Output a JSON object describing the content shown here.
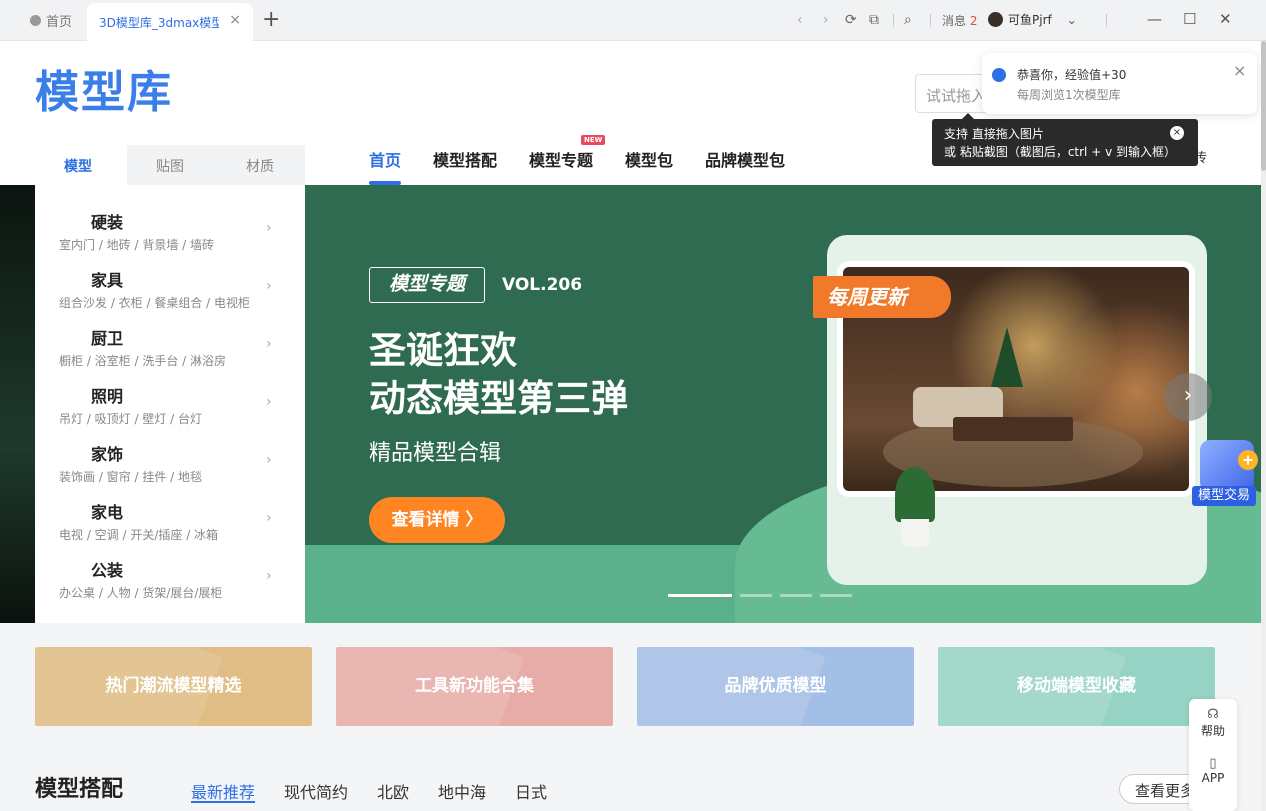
{
  "browser": {
    "home_tab": "首页",
    "active_tab": "3D模型库_3dmax模型库",
    "close": "×",
    "new_tab": "+",
    "back": "‹",
    "forward": "›",
    "reload": "⟳",
    "copy": "⧉",
    "search": "⌕",
    "messages_label": "消息",
    "messages_count": "2",
    "username": "可鱼Pjrf",
    "dropdown": "⌄",
    "minimize": "—",
    "maximize": "☐",
    "close_window": "✕"
  },
  "header": {
    "logo": "模型库",
    "search_placeholder": "试试拖入"
  },
  "side_tabs": [
    "模型",
    "贴图",
    "材质"
  ],
  "main_nav": [
    {
      "label": "首页"
    },
    {
      "label": "模型搭配"
    },
    {
      "label": "模型专题",
      "badge": "NEW"
    },
    {
      "label": "模型包"
    },
    {
      "label": "品牌模型包"
    }
  ],
  "upload_label": "模型上传",
  "categories": [
    {
      "title": "硬装",
      "sub": "室内门 / 地砖 / 背景墙 / 墙砖"
    },
    {
      "title": "家具",
      "sub": "组合沙发 / 衣柜 / 餐桌组合 / 电视柜"
    },
    {
      "title": "厨卫",
      "sub": "橱柜 / 浴室柜 / 洗手台 / 淋浴房"
    },
    {
      "title": "照明",
      "sub": "吊灯 / 吸顶灯 / 壁灯 / 台灯"
    },
    {
      "title": "家饰",
      "sub": "装饰画 / 窗帘 / 挂件 / 地毯"
    },
    {
      "title": "家电",
      "sub": "电视 / 空调 / 开关/插座 / 冰箱"
    },
    {
      "title": "公装",
      "sub": "办公桌 / 人物 / 货架/展台/展柜"
    }
  ],
  "category_arrow": "›",
  "banner": {
    "badge": "模型专题",
    "vol": "VOL.206",
    "line1": "圣诞狂欢",
    "line2": "动态模型第三弹",
    "subtitle": "精品模型合辑",
    "button": "查看详情 〉",
    "ribbon": "每周更新",
    "next": "›",
    "bg_color": "#2f6b51"
  },
  "quick_cards": [
    {
      "label": "热门潮流模型精选",
      "color": "#dfbd85"
    },
    {
      "label": "工具新功能合集",
      "color": "#e8aca8"
    },
    {
      "label": "品牌优质模型",
      "color": "#a4bfe6"
    },
    {
      "label": "移动端模型收藏",
      "color": "#97d3c4"
    }
  ],
  "section": {
    "title": "模型搭配",
    "tabs": [
      "最新推荐",
      "现代简约",
      "北欧",
      "地中海",
      "日式"
    ],
    "more": "查看更多"
  },
  "float_bar": [
    {
      "label": "帮助",
      "icon": "headset-icon",
      "glyph": "☊"
    },
    {
      "label": "APP",
      "icon": "phone-icon",
      "glyph": "▯"
    }
  ],
  "trade_widget": {
    "label": "模型交易",
    "plus": "+"
  },
  "notification": {
    "line1": "恭喜你，经验值+30",
    "line2": "每周浏览1次模型库",
    "close": "×"
  },
  "tooltip": {
    "line1": "支持 直接拖入图片",
    "line2": "或 粘贴截图（截图后，ctrl + v 到输入框）",
    "close": "×"
  },
  "colors": {
    "accent": "#2f6fe4",
    "orange": "#ff8422"
  }
}
